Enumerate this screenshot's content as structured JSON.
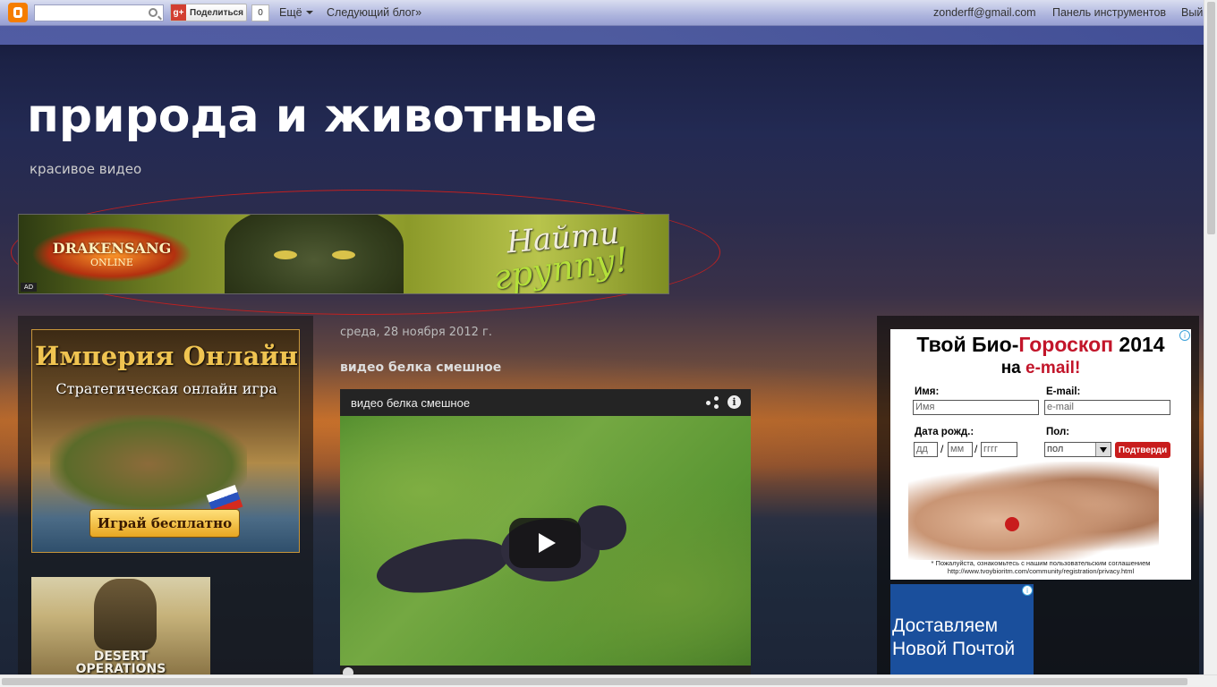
{
  "navbar": {
    "share_label": "Поделиться",
    "gplus_label": "g+",
    "share_count": "0",
    "more_label": "Ещё",
    "next_blog_label": "Следующий блог»",
    "email": "zonderff@gmail.com",
    "dashboard_label": "Панель инструментов",
    "exit_label": "Вый"
  },
  "blog": {
    "title": "природа и животные",
    "description": "красивое видео"
  },
  "top_banner": {
    "brand_line1": "DRAKENSANG",
    "brand_line2": "ONLINE",
    "cta_line1": "Найти",
    "cta_line2": "группу!",
    "ad_mark": "AD"
  },
  "left_ads": {
    "empire": {
      "title": "Империя Онлайн",
      "subtitle": "Стратегическая онлайн игра",
      "button": "Играй бесплатно"
    },
    "desert": {
      "line1": "DESERT",
      "line2": "OPERATIONS"
    }
  },
  "post": {
    "date": "среда, 28 ноября 2012 г.",
    "title": "видео белка смешное",
    "video_title": "видео белка смешное",
    "info_glyph": "i"
  },
  "right_ads": {
    "horoscope": {
      "title_part1": "Твой Био-",
      "title_part2": "Гороскоп",
      "title_part3": " 2014",
      "sub_part1": "на ",
      "sub_part2": "e-mail!",
      "name_label": "Имя:",
      "name_placeholder": "Имя",
      "email_label": "E-mail:",
      "email_placeholder": "e-mail",
      "dob_label": "Дата рожд.:",
      "day_placeholder": "дд",
      "month_placeholder": "мм",
      "year_placeholder": "гггг",
      "gender_label": "Пол:",
      "gender_value": "пол",
      "submit_label": "Подтверди",
      "note_line1": "* Пожалуйста, ознакомьтесь с нашим пользовательским соглашением",
      "note_line2": "http://www.tvoybioritm.com/community/registration/privacy.html",
      "adchoice": "i"
    },
    "novaposhta": {
      "line1": "Доставляем",
      "line2": "Новой Почтой",
      "adchoice": "i"
    }
  }
}
